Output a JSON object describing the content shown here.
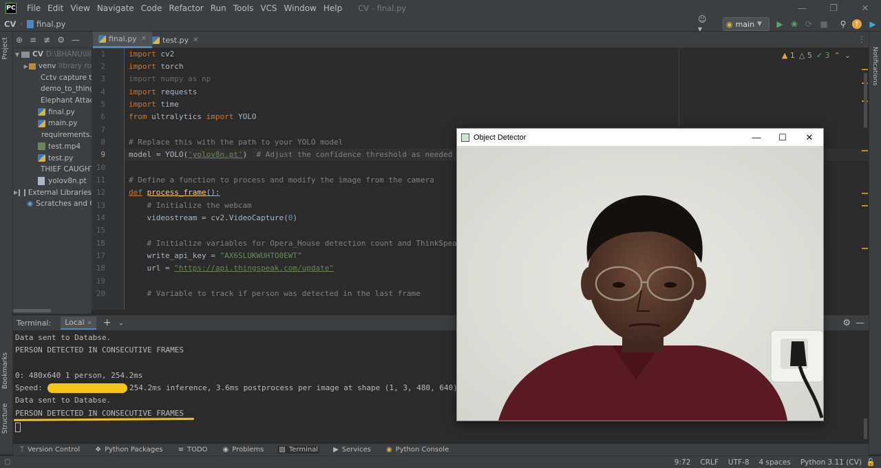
{
  "menubar": {
    "items": [
      "File",
      "Edit",
      "View",
      "Navigate",
      "Code",
      "Refactor",
      "Run",
      "Tools",
      "VCS",
      "Window",
      "Help"
    ],
    "window_title": "CV - final.py"
  },
  "navbar": {
    "project": "CV",
    "file": "final.py",
    "branch": "main"
  },
  "project_panel": {
    "root_label": "CV",
    "root_path": "D:\\BHANU\\III",
    "items": [
      {
        "label": "venv",
        "extra": "library ro"
      },
      {
        "label": "Cctv capture th"
      },
      {
        "label": "demo_to_thing"
      },
      {
        "label": "Elephant Attac"
      },
      {
        "label": "final.py"
      },
      {
        "label": "main.py"
      },
      {
        "label": "requirements.t"
      },
      {
        "label": "test.mp4"
      },
      {
        "label": "test.py"
      },
      {
        "label": "THIEF CAUGHT"
      },
      {
        "label": "yolov8n.pt"
      },
      {
        "label": "External Libraries"
      },
      {
        "label": "Scratches and Cor"
      }
    ]
  },
  "left_stripe": {
    "project": "Project",
    "bookmarks": "Bookmarks",
    "structure": "Structure"
  },
  "right_stripe": {
    "notifications": "Notifications"
  },
  "editor": {
    "tabs": [
      {
        "label": "final.py"
      },
      {
        "label": "test.py"
      }
    ],
    "inspections": {
      "errors": "1",
      "warnings": "5",
      "ok": "3"
    }
  },
  "code": {
    "line_numbers": [
      "1",
      "2",
      "3",
      "4",
      "5",
      "6",
      "7",
      "8",
      "9",
      "10",
      "11",
      "12",
      "13",
      "14",
      "15",
      "16",
      "17",
      "18",
      "19",
      "20"
    ],
    "l1": {
      "kw": "import",
      "rest": " cv2"
    },
    "l2": {
      "kw": "import",
      "rest": " torch"
    },
    "l3": {
      "text": "import numpy as np"
    },
    "l4": {
      "kw": "import",
      "rest": " requests"
    },
    "l5": {
      "kw": "import",
      "rest": " time"
    },
    "l6": {
      "kw1": "from",
      "mid": " ultralytics ",
      "kw2": "import",
      "rest": " YOLO"
    },
    "l8": {
      "comment": "# Replace this with the path to your YOLO model"
    },
    "l9": {
      "pre": "model = YOLO(",
      "str": "'yolov8n.pt'",
      "post": ")  ",
      "comment": "# Adjust the confidence threshold as needed"
    },
    "l11": {
      "comment": "# Define a function to process and modify the image from the camera"
    },
    "l12": {
      "kw": "def",
      "sp": " ",
      "fn": "process_frame",
      "rest": "():"
    },
    "l13": {
      "comment": "    # Initialize the webcam"
    },
    "l14": {
      "pre": "    videostream = cv2.VideoCapture(",
      "num": "0",
      "post": ")"
    },
    "l16": {
      "comment": "    # Initialize variables for Opera_House detection count and ThinkSpea"
    },
    "l17": {
      "pre": "    write_api_key = ",
      "str": "\"AX6SLUKWUHTO0EWT\""
    },
    "l18": {
      "pre": "    url = ",
      "str": "\"https://api.thingspeak.com/update\""
    },
    "l20": {
      "comment": "    # Variable to track if person was detected in the last frame"
    }
  },
  "terminal": {
    "title": "Terminal:",
    "tab": "Local",
    "lines": [
      "Data sent to Databse.",
      "PERSON DETECTED IN CONSECUTIVE FRAMES",
      "",
      "0: 480x640 1 person, 254.2ms",
      "Speed: 4",
      "Data sent to Databse.",
      "PERSON DETECTED IN CONSECUTIVE FRAMES"
    ],
    "speed_tail": "254.2ms inference, 3.6ms postprocess per image at shape (1, 3, 480, 640)"
  },
  "bottom_tools": [
    "Version Control",
    "Python Packages",
    "TODO",
    "Problems",
    "Terminal",
    "Services",
    "Python Console"
  ],
  "status": {
    "position": "9:72",
    "line_sep": "CRLF",
    "encoding": "UTF-8",
    "indent": "4 spaces",
    "interpreter": "Python 3.11 (CV)"
  },
  "object_detector": {
    "title": "Object Detector"
  },
  "colors": {
    "accent": "#4a88c7",
    "highlight": "#f5c518",
    "keyword": "#cc7832",
    "string": "#6a8759",
    "comment": "#808080"
  }
}
